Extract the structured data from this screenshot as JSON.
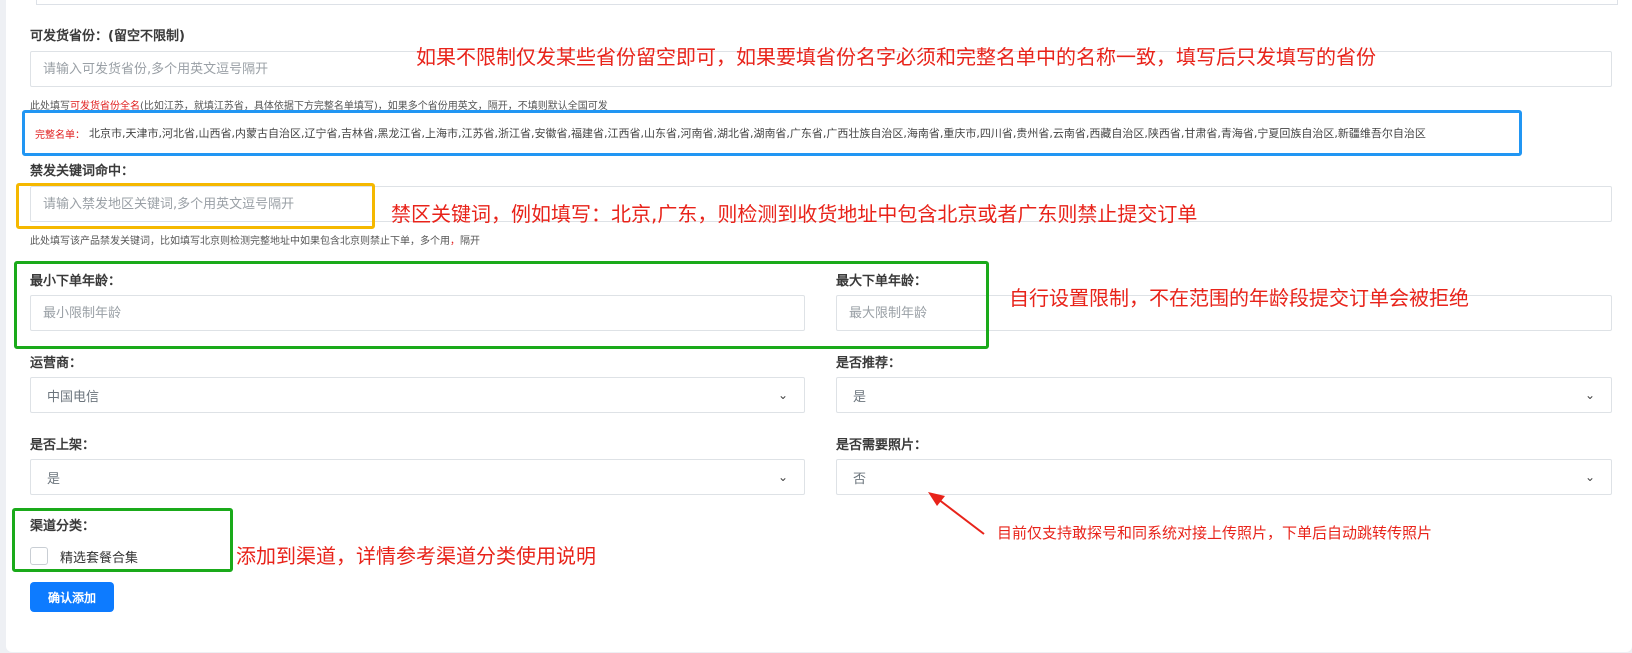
{
  "province": {
    "label": "可发货省份：(留空不限制)",
    "placeholder": "请输入可发货省份,多个用英文逗号隔开",
    "hint_pre": "此处填写",
    "hint_red": "可发货省份全名",
    "hint_post": "(比如江苏，就填江苏省，具体依据下方完整名单填写)，如果多个省份用英文，隔开，不填则默认全国可发",
    "full_list_tag": "完整名单：",
    "full_list": "北京市,天津市,河北省,山西省,内蒙古自治区,辽宁省,吉林省,黑龙江省,上海市,江苏省,浙江省,安徽省,福建省,江西省,山东省,河南省,湖北省,湖南省,广东省,广西壮族自治区,海南省,重庆市,四川省,贵州省,云南省,西藏自治区,陕西省,甘肃省,青海省,宁夏回族自治区,新疆维吾尔自治区"
  },
  "keywords": {
    "label": "禁发关键词命中：",
    "placeholder": "请输入禁发地区关键词,多个用英文逗号隔开",
    "hint_pre": "此处填写该产品禁发关键词，比如填写北京则检测完整地址中如果包含北京则禁止下单，多个用",
    "hint_red": "，",
    "hint_post": "隔开"
  },
  "age": {
    "min_label": "最小下单年龄：",
    "min_placeholder": "最小限制年龄",
    "max_label": "最大下单年龄：",
    "max_placeholder": "最大限制年龄"
  },
  "operator": {
    "label": "运营商：",
    "value": "中国电信"
  },
  "recommend": {
    "label": "是否推荐：",
    "value": "是"
  },
  "listed": {
    "label": "是否上架：",
    "value": "是"
  },
  "photo": {
    "label": "是否需要照片：",
    "value": "否"
  },
  "channel": {
    "label": "渠道分类：",
    "option": "精选套餐合集"
  },
  "submit_label": "确认添加",
  "annotations": {
    "province": "如果不限制仅发某些省份留空即可，如果要填省份名字必须和完整名单中的名称一致，填写后只发填写的省份",
    "keywords": "禁区关键词，例如填写：北京,广东，则检测到收货地址中包含北京或者广东则禁止提交订单",
    "age": "自行设置限制，不在范围的年龄段提交订单会被拒绝",
    "channel": "添加到渠道，详情参考渠道分类使用说明",
    "photo": "目前仅支持敢探号和同系统对接上传照片，下单后自动跳转传照片"
  },
  "colors": {
    "annotation_text": "#e8231a",
    "list_box": "#2196f3",
    "keyword_box": "#f5b800",
    "age_box": "#1aaa1a",
    "button": "#0d7bff"
  },
  "icons": [
    "chevron-down-icon",
    "red-arrow"
  ]
}
